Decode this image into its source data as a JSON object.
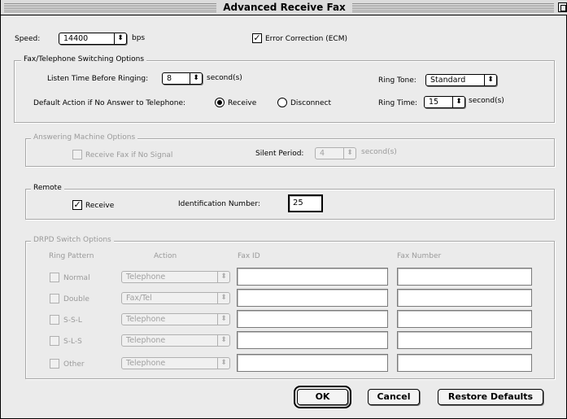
{
  "window": {
    "title": "Advanced Receive Fax"
  },
  "speed": {
    "label": "Speed:",
    "value": "14400",
    "unit": "bps"
  },
  "ecm": {
    "label": "Error Correction (ECM)",
    "checked": true
  },
  "fax_tel": {
    "title": "Fax/Telephone Switching Options",
    "listen_label": "Listen Time Before Ringing:",
    "listen_value": "8",
    "listen_unit": "second(s)",
    "ring_tone_label": "Ring Tone:",
    "ring_tone_value": "Standard",
    "default_action_label": "Default Action if No Answer to Telephone:",
    "receive_label": "Receive",
    "disconnect_label": "Disconnect",
    "ring_time_label": "Ring Time:",
    "ring_time_value": "15",
    "ring_time_unit": "second(s)"
  },
  "answering": {
    "title": "Answering Machine Options",
    "receive_no_signal_label": "Receive Fax if No Signal",
    "silent_label": "Silent Period:",
    "silent_value": "4",
    "silent_unit": "second(s)"
  },
  "remote": {
    "title": "Remote",
    "receive_label": "Receive",
    "receive_checked": true,
    "id_label": "Identification Number:",
    "id_value": "25"
  },
  "drpd": {
    "title": "DRPD Switch Options",
    "headers": {
      "ring_pattern": "Ring Pattern",
      "action": "Action",
      "fax_id": "Fax ID",
      "fax_number": "Fax Number"
    },
    "rows": [
      {
        "pattern": "Normal",
        "action": "Telephone"
      },
      {
        "pattern": "Double",
        "action": "Fax/Tel"
      },
      {
        "pattern": "S-S-L",
        "action": "Telephone"
      },
      {
        "pattern": "S-L-S",
        "action": "Telephone"
      },
      {
        "pattern": "Other",
        "action": "Telephone"
      }
    ]
  },
  "buttons": {
    "ok": "OK",
    "cancel": "Cancel",
    "restore": "Restore Defaults"
  },
  "icons": {
    "checkmark": "✓",
    "popup_arrow": "⬍"
  }
}
